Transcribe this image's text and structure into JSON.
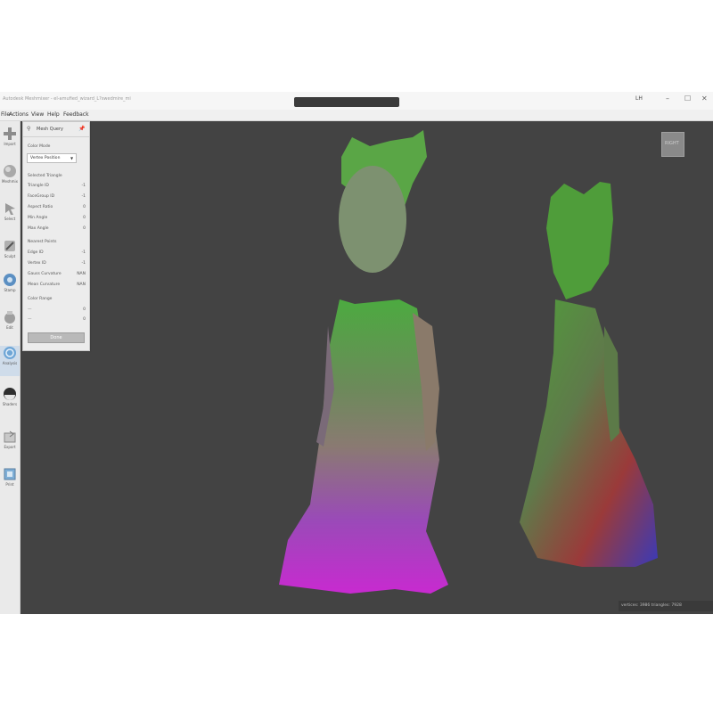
{
  "window": {
    "title": "Autodesk Meshmixer - el-amufied_wizard_L?swedmire_mi",
    "user": "LH",
    "controls": [
      "–",
      "☐",
      "✕"
    ]
  },
  "menu": [
    "File",
    "Actions",
    "View",
    "Help",
    "Feedback"
  ],
  "toolbar": [
    {
      "label": "Import",
      "icon": "plus-icon"
    },
    {
      "label": "Meshmix",
      "icon": "sphere-icon"
    },
    {
      "label": "Select",
      "icon": "select-arrow-icon"
    },
    {
      "label": "Sculpt",
      "icon": "brush-icon"
    },
    {
      "label": "Stamp",
      "icon": "stamp-icon"
    },
    {
      "label": "Edit",
      "icon": "edit-icon"
    },
    {
      "label": "Analysis",
      "icon": "analysis-icon"
    },
    {
      "label": "Shaders",
      "icon": "shaders-icon"
    },
    {
      "label": "Export",
      "icon": "export-icon"
    },
    {
      "label": "Print",
      "icon": "print-icon"
    }
  ],
  "panel": {
    "title": "Mesh Query",
    "color_mode_label": "Color Mode",
    "color_mode_value": "Vertex Position",
    "selected_triangle_heading": "Selected Triangle",
    "triangle_rows": [
      {
        "label": "Triangle ID",
        "value": "-1"
      },
      {
        "label": "FaceGroup ID",
        "value": "-1"
      },
      {
        "label": "Aspect Ratio",
        "value": "0"
      },
      {
        "label": "Min Angle",
        "value": "0"
      },
      {
        "label": "Max Angle",
        "value": "0"
      }
    ],
    "nearest_points_heading": "Nearest Points",
    "nearest_rows": [
      {
        "label": "Edge ID",
        "value": "-1"
      },
      {
        "label": "Vertex ID",
        "value": "-1"
      },
      {
        "label": "Gauss Curvature",
        "value": "NAN"
      },
      {
        "label": "Mean Curvature",
        "value": "NAN"
      }
    ],
    "color_range_heading": "Color Range",
    "color_range_rows": [
      {
        "label": "—",
        "value": "0"
      },
      {
        "label": "—",
        "value": "0"
      }
    ],
    "done_label": "Done"
  },
  "viewcube_label": "RIGHT",
  "status_text": "vertices: 3986 triangles: 7928",
  "colors": {
    "viewport_bg": "#434343",
    "accent_active": "#cfdcea"
  }
}
